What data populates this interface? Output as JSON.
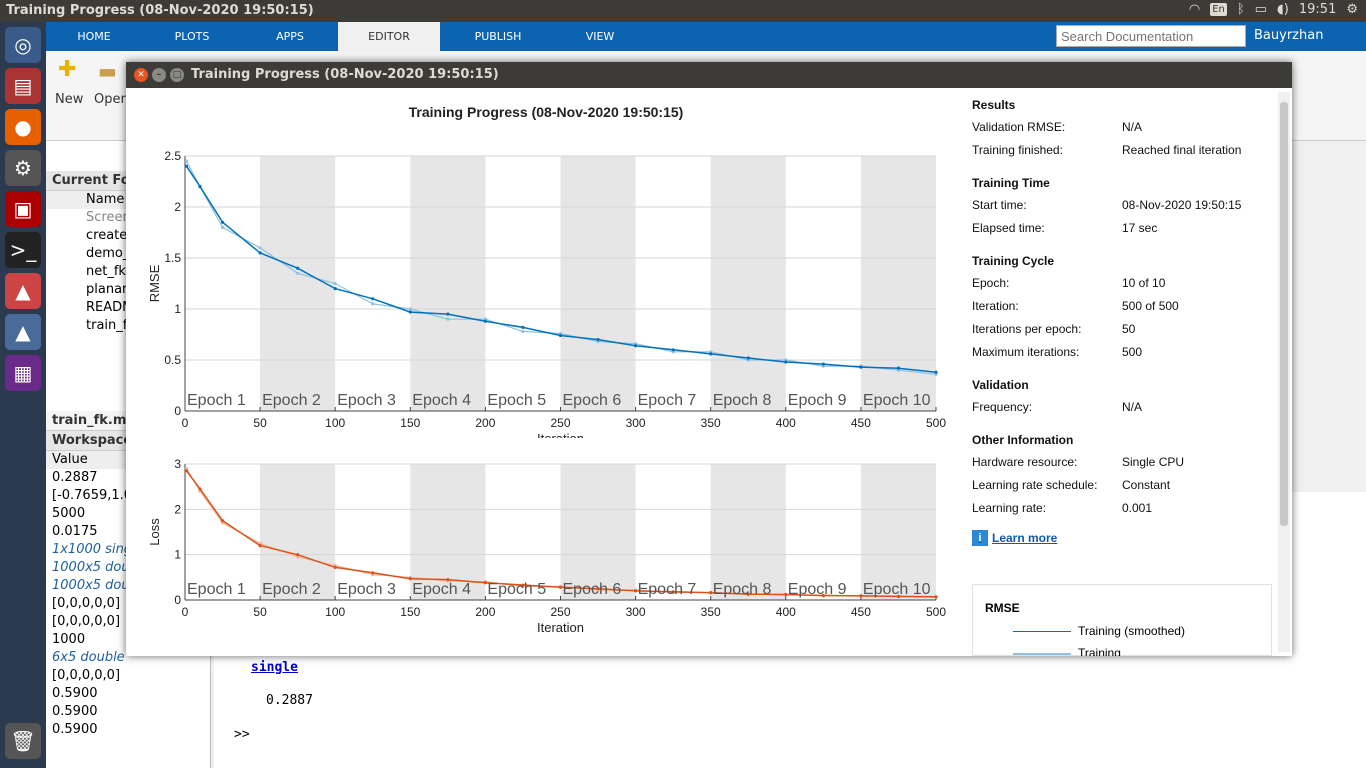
{
  "os": {
    "window_title": "Training Progress (08-Nov-2020 19:50:15)",
    "lang": "En",
    "clock": "19:51",
    "user": "Bauyrzhan"
  },
  "matlab": {
    "tabs": [
      "HOME",
      "PLOTS",
      "APPS",
      "EDITOR",
      "PUBLISH",
      "VIEW"
    ],
    "search_placeholder": "Search Documentation",
    "ribbon": {
      "new": "New",
      "open": "Open"
    },
    "current_folder": "Current Fo",
    "name_col": "Name",
    "files": [
      "Screen",
      "create",
      "demo_",
      "net_fk",
      "planar",
      "READM",
      "train_f"
    ],
    "editor_file": "train_fk.m",
    "workspace": "Workspace",
    "value_col": "Value",
    "values": [
      "0.2887",
      "[-0.7659,1.0",
      "5000",
      "0.0175",
      "1x1000 sing",
      "1000x5 dou",
      "1000x5 dou",
      "[0,0,0,0,0]",
      "[0,0,0,0,0]",
      "1000",
      "6x5 double",
      "[0,0,0,0,0]",
      "0.5900",
      "0.5900",
      "0.5900"
    ],
    "cmd": {
      "type": "single",
      "value": "0.2887",
      "prompt": ">>"
    }
  },
  "window": {
    "title": "Training Progress (08-Nov-2020 19:50:15)",
    "plot_title": "Training Progress (08-Nov-2020 19:50:15)"
  },
  "info": {
    "results": "Results",
    "validation_rmse_k": "Validation RMSE:",
    "validation_rmse_v": "N/A",
    "training_finished_k": "Training finished:",
    "training_finished_v": "Reached final iteration",
    "training_time": "Training Time",
    "start_time_k": "Start time:",
    "start_time_v": "08-Nov-2020 19:50:15",
    "elapsed_k": "Elapsed time:",
    "elapsed_v": "17 sec",
    "training_cycle": "Training Cycle",
    "epoch_k": "Epoch:",
    "epoch_v": "10 of 10",
    "iteration_k": "Iteration:",
    "iteration_v": "500 of 500",
    "ipe_k": "Iterations per epoch:",
    "ipe_v": "50",
    "maxit_k": "Maximum iterations:",
    "maxit_v": "500",
    "validation": "Validation",
    "freq_k": "Frequency:",
    "freq_v": "N/A",
    "other": "Other Information",
    "hw_k": "Hardware resource:",
    "hw_v": "Single CPU",
    "lrs_k": "Learning rate schedule:",
    "lrs_v": "Constant",
    "lr_k": "Learning rate:",
    "lr_v": "0.001",
    "learn_more": "Learn more"
  },
  "legend": {
    "title": "RMSE",
    "smoothed": "Training (smoothed)",
    "training": "Training"
  },
  "chart_data": [
    {
      "type": "line",
      "ylabel": "RMSE",
      "xlabel": "Iteration",
      "xlim": [
        0,
        500
      ],
      "ylim": [
        0,
        2.5
      ],
      "xticks": [
        0,
        50,
        100,
        150,
        200,
        250,
        300,
        350,
        400,
        450,
        500
      ],
      "yticks": [
        0,
        0.5,
        1,
        1.5,
        2,
        2.5
      ],
      "epoch_labels": [
        "Epoch 1",
        "Epoch 2",
        "Epoch 3",
        "Epoch 4",
        "Epoch 5",
        "Epoch 6",
        "Epoch 7",
        "Epoch 8",
        "Epoch 9",
        "Epoch 10"
      ],
      "series": [
        {
          "name": "Training (smoothed)",
          "color": "#0072bd",
          "x": [
            1,
            10,
            25,
            50,
            75,
            100,
            125,
            150,
            175,
            200,
            225,
            250,
            275,
            300,
            325,
            350,
            375,
            400,
            425,
            450,
            475,
            500
          ],
          "values": [
            2.4,
            2.2,
            1.85,
            1.55,
            1.4,
            1.2,
            1.1,
            0.97,
            0.95,
            0.88,
            0.82,
            0.74,
            0.7,
            0.64,
            0.6,
            0.56,
            0.52,
            0.48,
            0.46,
            0.43,
            0.42,
            0.38
          ]
        },
        {
          "name": "Training",
          "color": "#8ec1e3",
          "x": [
            1,
            10,
            25,
            50,
            75,
            100,
            125,
            150,
            175,
            200,
            225,
            250,
            275,
            300,
            325,
            350,
            375,
            400,
            425,
            450,
            475,
            500
          ],
          "values": [
            2.45,
            2.2,
            1.8,
            1.6,
            1.35,
            1.25,
            1.05,
            1.0,
            0.9,
            0.9,
            0.78,
            0.76,
            0.68,
            0.66,
            0.58,
            0.58,
            0.5,
            0.5,
            0.44,
            0.44,
            0.4,
            0.36
          ]
        }
      ]
    },
    {
      "type": "line",
      "ylabel": "Loss",
      "xlabel": "Iteration",
      "xlim": [
        0,
        500
      ],
      "ylim": [
        0,
        3
      ],
      "xticks": [
        0,
        50,
        100,
        150,
        200,
        250,
        300,
        350,
        400,
        450,
        500
      ],
      "yticks": [
        0,
        1,
        2,
        3
      ],
      "epoch_labels": [
        "Epoch 1",
        "Epoch 2",
        "Epoch 3",
        "Epoch 4",
        "Epoch 5",
        "Epoch 6",
        "Epoch 7",
        "Epoch 8",
        "Epoch 9",
        "Epoch 10"
      ],
      "series": [
        {
          "name": "Training (smoothed)",
          "color": "#d95319",
          "x": [
            1,
            10,
            25,
            50,
            75,
            100,
            125,
            150,
            175,
            200,
            225,
            250,
            275,
            300,
            325,
            350,
            375,
            400,
            425,
            450,
            475,
            500
          ],
          "values": [
            2.85,
            2.45,
            1.75,
            1.2,
            1.0,
            0.72,
            0.6,
            0.47,
            0.45,
            0.38,
            0.33,
            0.28,
            0.25,
            0.2,
            0.18,
            0.16,
            0.13,
            0.12,
            0.1,
            0.09,
            0.08,
            0.07
          ]
        },
        {
          "name": "Training",
          "color": "#f4b49a",
          "x": [
            1,
            10,
            25,
            50,
            75,
            100,
            125,
            150,
            175,
            200,
            225,
            250,
            275,
            300,
            325,
            350,
            375,
            400,
            425,
            450,
            475,
            500
          ],
          "values": [
            2.9,
            2.4,
            1.7,
            1.25,
            0.95,
            0.76,
            0.56,
            0.5,
            0.42,
            0.4,
            0.3,
            0.3,
            0.22,
            0.22,
            0.16,
            0.17,
            0.12,
            0.13,
            0.09,
            0.1,
            0.07,
            0.06
          ]
        }
      ]
    }
  ]
}
